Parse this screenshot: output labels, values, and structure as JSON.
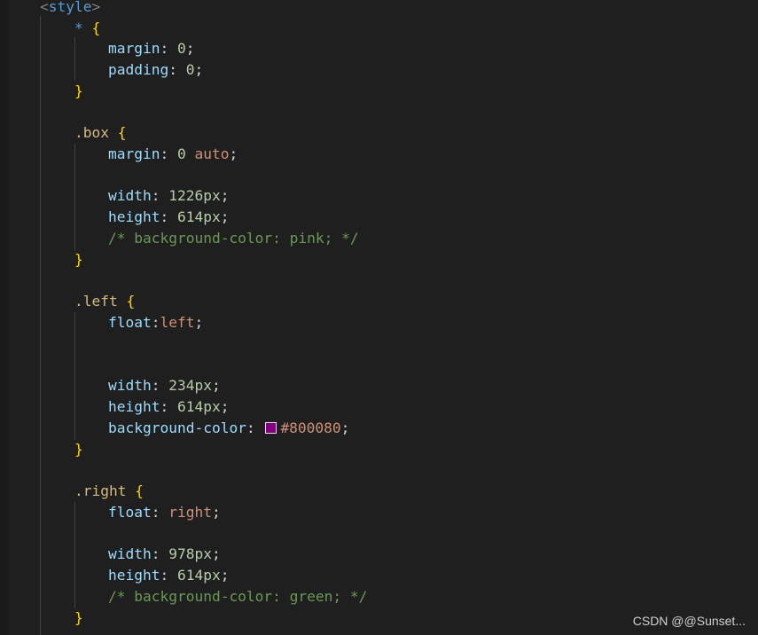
{
  "code": {
    "style_open": {
      "bracket_open": "<",
      "tag": "style",
      "bracket_close": ">"
    },
    "rule_universal": {
      "selector": "*",
      "open_brace": "{",
      "close_brace": "}",
      "margin": {
        "prop": "margin",
        "value": "0"
      },
      "padding": {
        "prop": "padding",
        "value": "0"
      }
    },
    "rule_box": {
      "selector": ".box",
      "open_brace": "{",
      "close_brace": "}",
      "margin": {
        "prop": "margin",
        "value_num": "0",
        "value_kw": "auto"
      },
      "width": {
        "prop": "width",
        "value": "1226px"
      },
      "height": {
        "prop": "height",
        "value": "614px"
      },
      "comment": "/* background-color: pink; */"
    },
    "rule_left": {
      "selector": ".left",
      "open_brace": "{",
      "close_brace": "}",
      "float": {
        "prop": "float",
        "value": "left"
      },
      "width": {
        "prop": "width",
        "value": "234px"
      },
      "height": {
        "prop": "height",
        "value": "614px"
      },
      "background": {
        "prop": "background-color",
        "value": "#800080",
        "swatch_color": "#800080"
      }
    },
    "rule_right": {
      "selector": ".right",
      "open_brace": "{",
      "close_brace": "}",
      "float": {
        "prop": "float",
        "value": "right"
      },
      "width": {
        "prop": "width",
        "value": "978px"
      },
      "height": {
        "prop": "height",
        "value": "614px"
      },
      "comment": "/* background-color: green; */"
    }
  },
  "watermark": "CSDN @@Sunset..."
}
